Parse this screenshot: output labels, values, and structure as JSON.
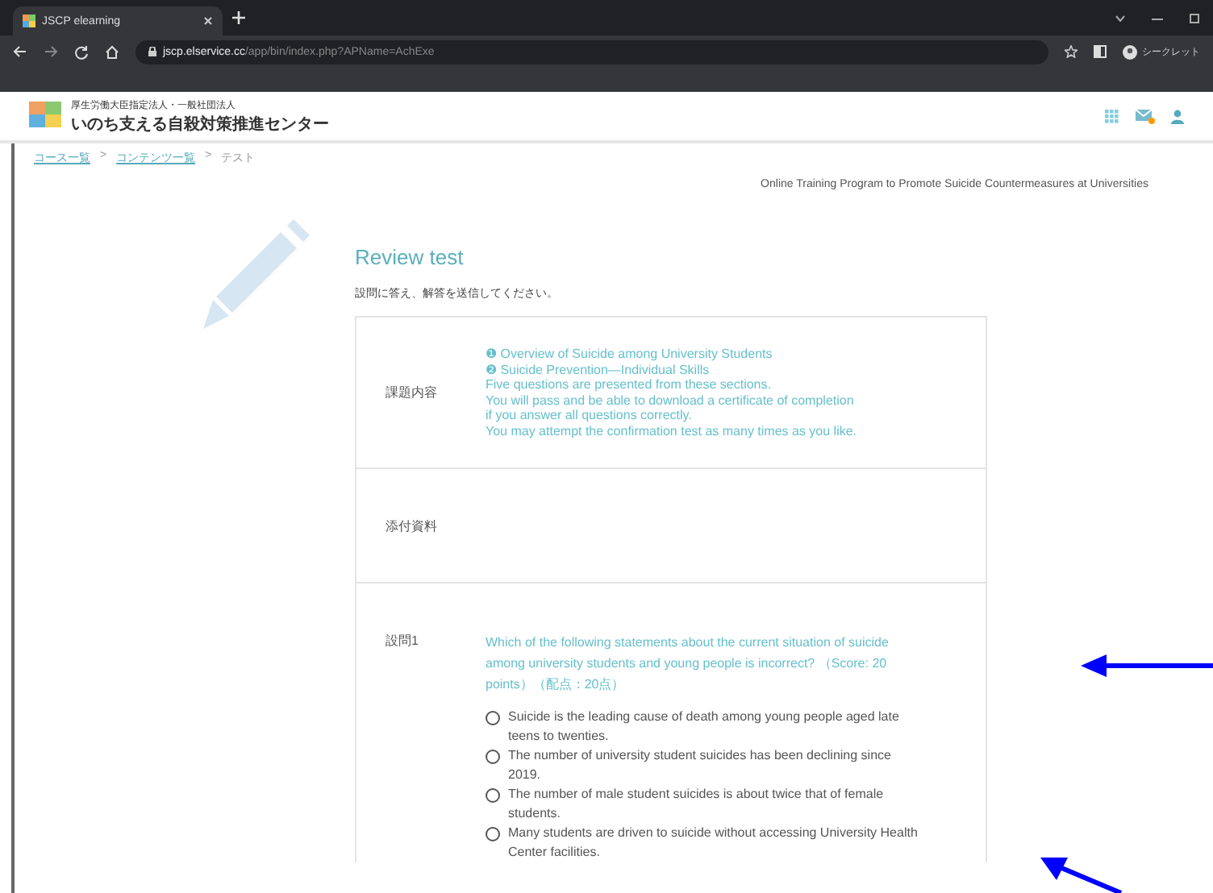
{
  "browser": {
    "tab_title": "JSCP elearning",
    "url_host": "jscp.elservice.cc",
    "url_path": "/app/bin/index.php?APName=AchExe",
    "profile": "シークレット"
  },
  "header": {
    "org_subtitle": "厚生労働大臣指定法人・一般社団法人",
    "org_name": "いのち支える自殺対策推進センター"
  },
  "breadcrumbs": [
    {
      "label": "コース一覧",
      "link": true
    },
    {
      "separator": ">",
      "label": "コンテンツ一覧",
      "link": true
    },
    {
      "separator": ">",
      "label": "テスト",
      "link": false
    }
  ],
  "program_title": "Online Training Program to Promote Suicide Countermeasures at Universities",
  "page_title": "Review test",
  "instruction": "設問に答え、解答を送信してください。",
  "rows": [
    {
      "label": "課題内容",
      "lines": [
        "❶ Overview of Suicide among University Students",
        "❷ Suicide Prevention―Individual Skills",
        "Five questions are presented from these sections.",
        "You will pass and be able to download a certificate of completion",
        "if you answer all questions correctly.",
        "You may attempt the confirmation test as many times as you like."
      ]
    },
    {
      "label": "添付資料",
      "lines": []
    }
  ],
  "question": {
    "label": "設問1",
    "text": "Which of the following statements about the current situation of suicide among university students and young people is incorrect? （Score: 20 points）（配点：20点）",
    "options": [
      {
        "text": "Suicide is the leading cause of death among young people aged late teens to twenties.",
        "selected": false
      },
      {
        "text": "The number of university student suicides has been declining since 2019.",
        "selected": false
      },
      {
        "text": "The number of male student suicides is about twice that of female students.",
        "selected": false
      },
      {
        "text": "Many students are driven to suicide without accessing University Health Center facilities.",
        "selected": false
      }
    ]
  }
}
